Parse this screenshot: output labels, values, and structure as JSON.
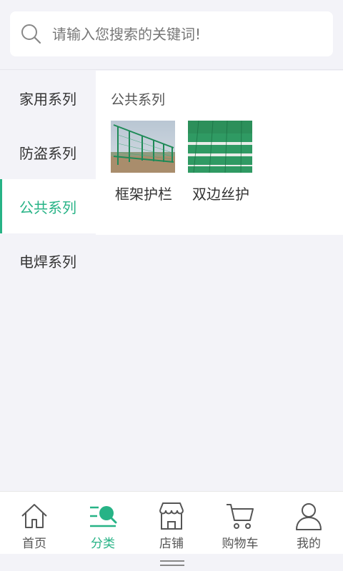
{
  "search": {
    "placeholder": "请输入您搜索的关键词!"
  },
  "sidebar": {
    "items": [
      {
        "label": "家用系列"
      },
      {
        "label": "防盗系列"
      },
      {
        "label": "公共系列"
      },
      {
        "label": "电焊系列"
      }
    ],
    "active_index": 2
  },
  "content": {
    "title": "公共系列",
    "products": [
      {
        "name": "框架护栏"
      },
      {
        "name": "双边丝护"
      }
    ]
  },
  "tabbar": {
    "items": [
      {
        "label": "首页",
        "icon": "home-icon"
      },
      {
        "label": "分类",
        "icon": "category-icon"
      },
      {
        "label": "店铺",
        "icon": "store-icon"
      },
      {
        "label": "购物车",
        "icon": "cart-icon"
      },
      {
        "label": "我的",
        "icon": "user-icon"
      }
    ],
    "active_index": 1
  },
  "colors": {
    "accent": "#27b386",
    "background": "#f3f3f8"
  }
}
